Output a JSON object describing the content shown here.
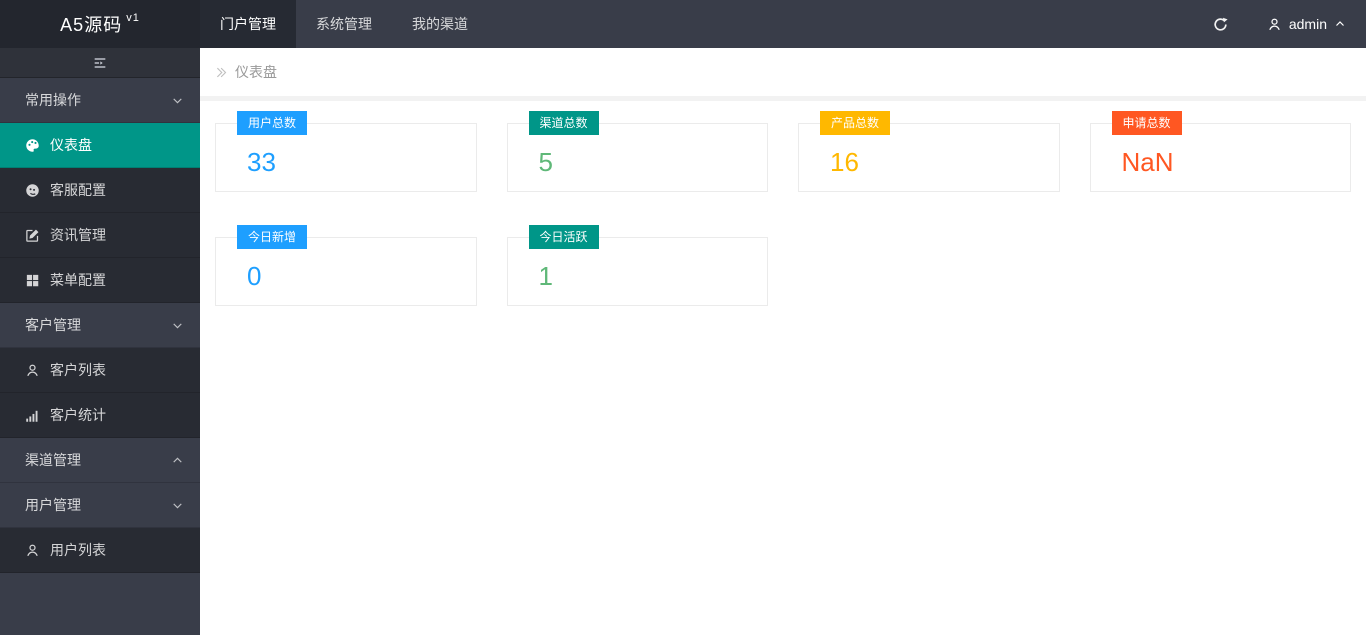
{
  "header": {
    "logo_title": "A5源码",
    "logo_version": "v1",
    "nav_items": [
      {
        "label": "门户管理",
        "active": true
      },
      {
        "label": "系统管理",
        "active": false
      },
      {
        "label": "我的渠道",
        "active": false
      }
    ],
    "username": "admin"
  },
  "sidebar": {
    "items": [
      {
        "label": "常用操作",
        "type": "group",
        "chevron": "down"
      },
      {
        "label": "仪表盘",
        "type": "sub",
        "icon": "dashboard-icon",
        "active": true
      },
      {
        "label": "客服配置",
        "type": "sub",
        "icon": "service-icon"
      },
      {
        "label": "资讯管理",
        "type": "sub",
        "icon": "edit-icon"
      },
      {
        "label": "菜单配置",
        "type": "sub",
        "icon": "grid-icon"
      },
      {
        "label": "客户管理",
        "type": "group",
        "chevron": "down"
      },
      {
        "label": "客户列表",
        "type": "sub",
        "icon": "person-icon"
      },
      {
        "label": "客户统计",
        "type": "sub",
        "icon": "bar-chart-icon"
      },
      {
        "label": "渠道管理",
        "type": "group",
        "chevron": "up"
      },
      {
        "label": "用户管理",
        "type": "group",
        "chevron": "down"
      },
      {
        "label": "用户列表",
        "type": "sub",
        "icon": "person-icon"
      }
    ]
  },
  "breadcrumb": {
    "current": "仪表盘"
  },
  "stats": [
    {
      "label": "用户总数",
      "value": "33",
      "badge_color": "#1E9FFF",
      "value_color": "#1E9FFF"
    },
    {
      "label": "渠道总数",
      "value": "5",
      "badge_color": "#009688",
      "value_color": "#5FB878"
    },
    {
      "label": "产品总数",
      "value": "16",
      "badge_color": "#FFB800",
      "value_color": "#FFB800"
    },
    {
      "label": "申请总数",
      "value": "NaN",
      "badge_color": "#FF5722",
      "value_color": "#FF5722"
    },
    {
      "label": "今日新增",
      "value": "0",
      "badge_color": "#1E9FFF",
      "value_color": "#1E9FFF"
    },
    {
      "label": "今日活跃",
      "value": "1",
      "badge_color": "#009688",
      "value_color": "#5FB878"
    }
  ],
  "colors": {
    "header_bg": "#393D49",
    "logo_bg": "#23262E",
    "sidebar_sub_bg": "#282B33",
    "active_teal": "#009688",
    "body_strip": "#f2f2f2"
  }
}
